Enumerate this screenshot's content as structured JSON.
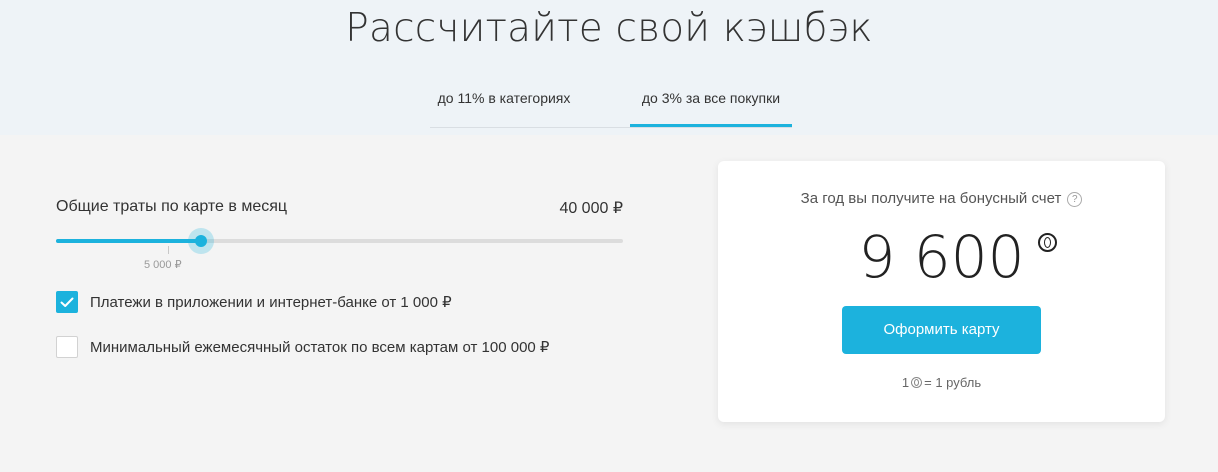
{
  "header": {
    "title": "Рассчитайте свой кэшбэк",
    "tabs": [
      {
        "label": "до 11% в категориях",
        "active": false
      },
      {
        "label": "до 3% за все покупки",
        "active": true
      }
    ]
  },
  "calculator": {
    "spend_label": "Общие траты по карте в месяц",
    "spend_value": "40 000 ₽",
    "slider": {
      "level_fraction": 0.26,
      "tick_label": "5 000 ₽"
    },
    "options": [
      {
        "label": "Платежи в приложении и интернет-банке от 1 000 ₽",
        "checked": true
      },
      {
        "label": "Минимальный ежемесячный остаток по всем картам от 100 000 ₽",
        "checked": false
      }
    ]
  },
  "result": {
    "caption": "За год вы получите на бонусный счет",
    "help_glyph": "?",
    "amount": "9 600",
    "cta_label": "Оформить карту",
    "rate_prefix": "1",
    "rate_suffix": "= 1 рубль"
  },
  "colors": {
    "accent": "#1cb2dd",
    "header_bg": "#eef3f7",
    "page_bg": "#f4f4f4"
  }
}
